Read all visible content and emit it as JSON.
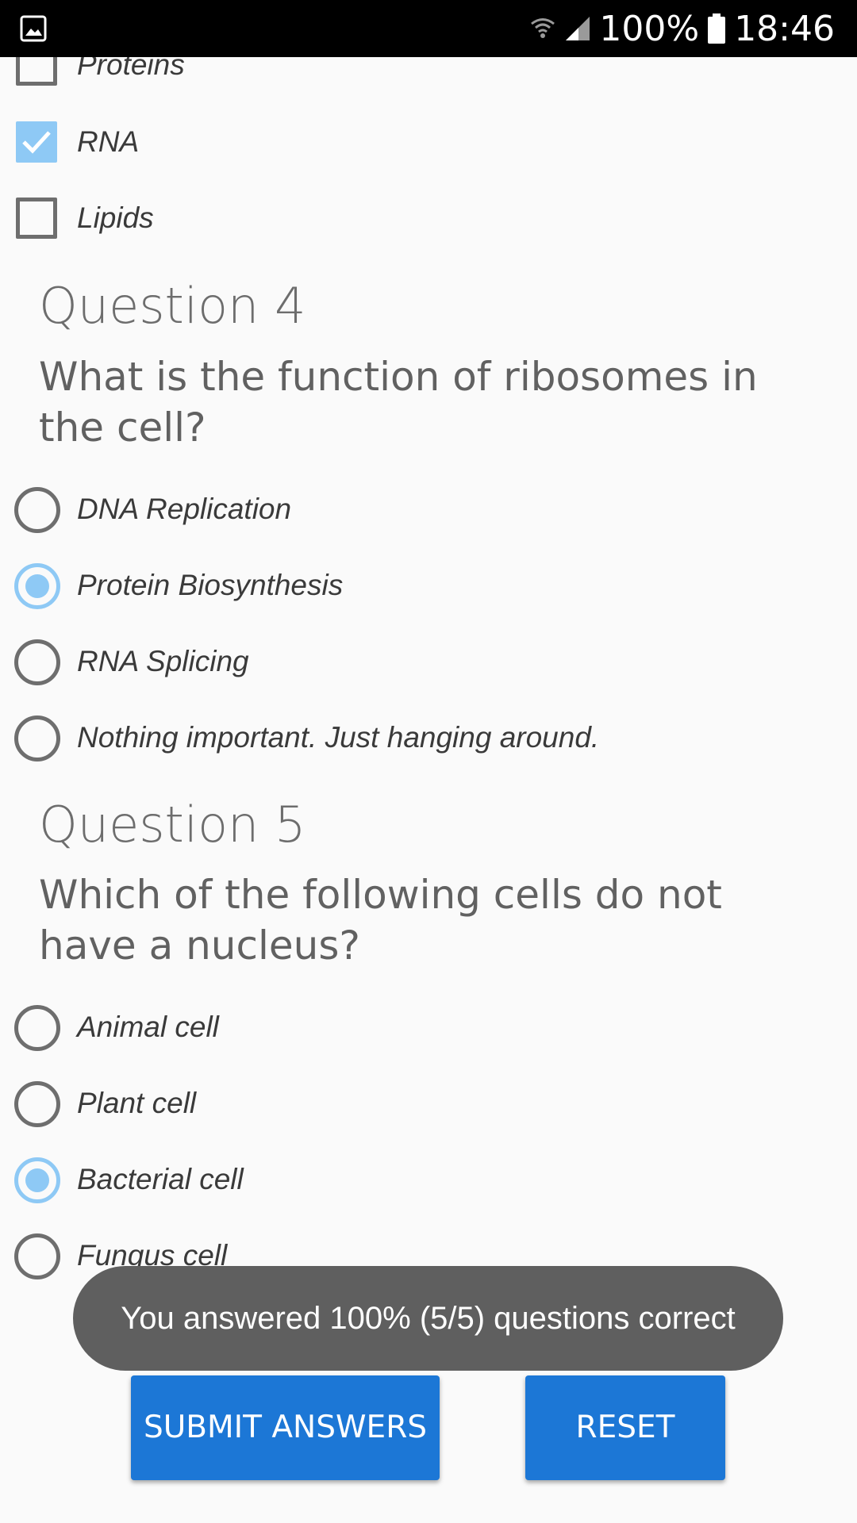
{
  "status_bar": {
    "battery": "100%",
    "time": "18:46",
    "icons": [
      "gallery-icon",
      "wifi-icon",
      "signal-icon",
      "battery-icon"
    ]
  },
  "question3_options": [
    {
      "label": "Proteins",
      "checked": false
    },
    {
      "label": "RNA",
      "checked": true
    },
    {
      "label": "Lipids",
      "checked": false
    }
  ],
  "question4": {
    "heading": "Question 4",
    "text": "What is the function of ribosomes in the cell?",
    "options": [
      {
        "label": "DNA Replication",
        "selected": false
      },
      {
        "label": "Protein Biosynthesis",
        "selected": true
      },
      {
        "label": "RNA Splicing",
        "selected": false
      },
      {
        "label": "Nothing important. Just hanging around.",
        "selected": false
      }
    ]
  },
  "question5": {
    "heading": "Question 5",
    "text": "Which of the following cells do not have a nucleus?",
    "options": [
      {
        "label": "Animal cell",
        "selected": false
      },
      {
        "label": "Plant cell",
        "selected": false
      },
      {
        "label": "Bacterial cell",
        "selected": true
      },
      {
        "label": "Fungus cell",
        "selected": false
      }
    ]
  },
  "toast": {
    "message": "You answered 100% (5/5) questions correct"
  },
  "buttons": {
    "submit_label": "SUBMIT ANSWERS",
    "reset_label": "RESET"
  },
  "colors": {
    "accent": "#8ec9f5",
    "button": "#1c77d6",
    "toast": "#5f5f5f"
  }
}
